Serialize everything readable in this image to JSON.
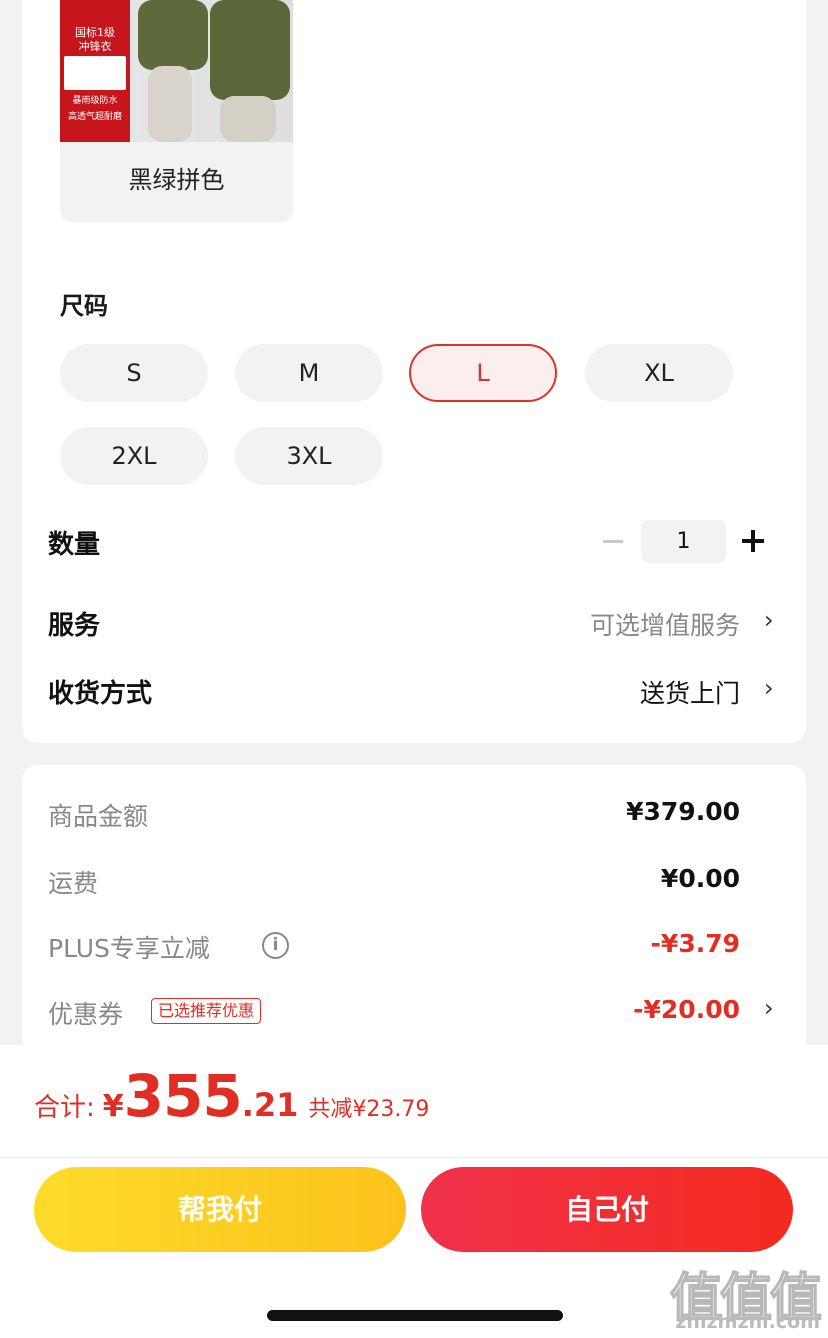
{
  "product": {
    "image_badge": [
      "国标1级",
      "冲锋衣"
    ],
    "image_strips": [
      "暴雨级防水",
      "高透气超耐磨"
    ],
    "color_label": "黑绿拼色"
  },
  "size": {
    "title": "尺码",
    "options": [
      "S",
      "M",
      "L",
      "XL",
      "2XL",
      "3XL"
    ],
    "selected": "L"
  },
  "quantity": {
    "label": "数量",
    "value": "1"
  },
  "service": {
    "label": "服务",
    "value": "可选增值服务",
    "icon": "chevron-right-icon"
  },
  "delivery": {
    "label": "收货方式",
    "value": "送货上门",
    "icon": "chevron-right-icon"
  },
  "price": {
    "goods_label": "商品金额",
    "goods_value": "¥379.00",
    "shipping_label": "运费",
    "shipping_value": "¥0.00",
    "plus_label": "PLUS专享立减",
    "plus_value": "-¥3.79",
    "coupon_label": "优惠券",
    "coupon_tag": "已选推荐优惠",
    "coupon_value": "-¥20.00"
  },
  "total": {
    "label": "合计:",
    "yen": "¥",
    "integer": "355",
    "decimal": ".21",
    "saved": "共减¥23.79"
  },
  "buttons": {
    "help_pay": "帮我付",
    "self_pay": "自己付"
  },
  "watermark": {
    "big": "值值值",
    "small": "zhizhizhi.com"
  },
  "colors": {
    "accent_red": "#e02e24",
    "yellow_btn": "#fcc21b",
    "red_btn": "#f42a1f"
  }
}
